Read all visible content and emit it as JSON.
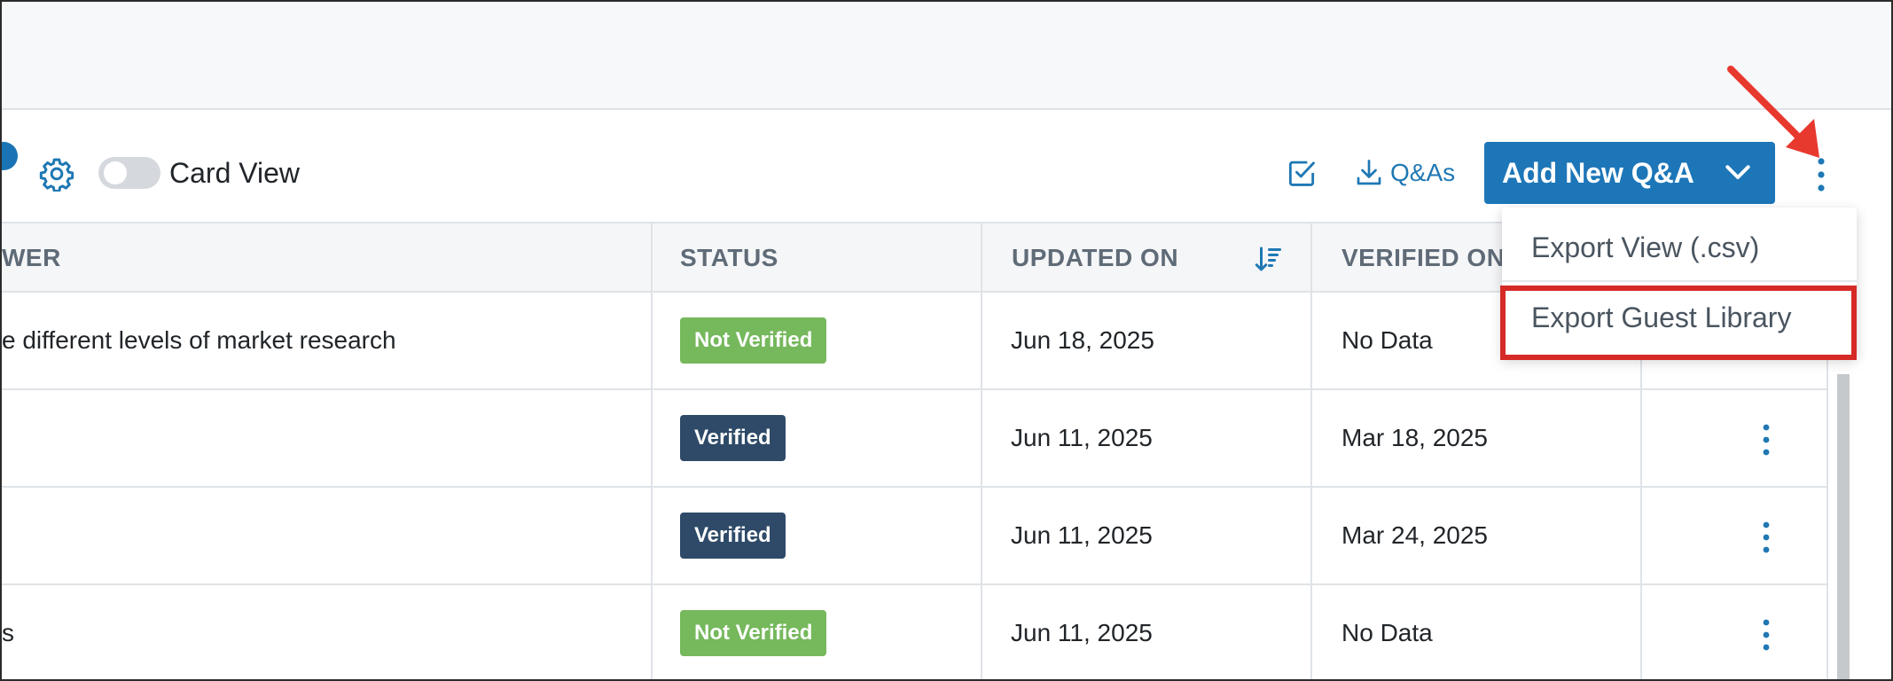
{
  "toolbar": {
    "card_view_label": "Card View",
    "download_label": "Q&As",
    "add_button_label": "Add New Q&A"
  },
  "table": {
    "headers": {
      "answer_partial": "WER",
      "status": "STATUS",
      "updated_on": "UPDATED ON",
      "verified_on": "VERIFIED ON"
    },
    "rows": [
      {
        "answer": "e different levels of market research",
        "status": "Not Verified",
        "status_color": "#76b85c",
        "updated_on": "Jun 18, 2025",
        "verified_on": "No Data"
      },
      {
        "answer": "",
        "status": "Verified",
        "status_color": "#2e4a68",
        "updated_on": "Jun 11, 2025",
        "verified_on": "Mar 18, 2025"
      },
      {
        "answer": "",
        "status": "Verified",
        "status_color": "#2e4a68",
        "updated_on": "Jun 11, 2025",
        "verified_on": "Mar 24, 2025"
      },
      {
        "answer": "s",
        "status": "Not Verified",
        "status_color": "#76b85c",
        "updated_on": "Jun 11, 2025",
        "verified_on": "No Data"
      }
    ]
  },
  "dropdown": {
    "items": [
      "Export View (.csv)",
      "Export Guest Library"
    ],
    "highlighted_item": "Export Guest Library"
  },
  "colors": {
    "accent": "#1d76b8",
    "annotation": "#e8392f"
  },
  "icons": [
    "gear-icon",
    "checkbox-icon",
    "download-icon",
    "chevron-down-icon",
    "more-vertical-icon",
    "sort-descending-icon",
    "arrow-annotation"
  ]
}
